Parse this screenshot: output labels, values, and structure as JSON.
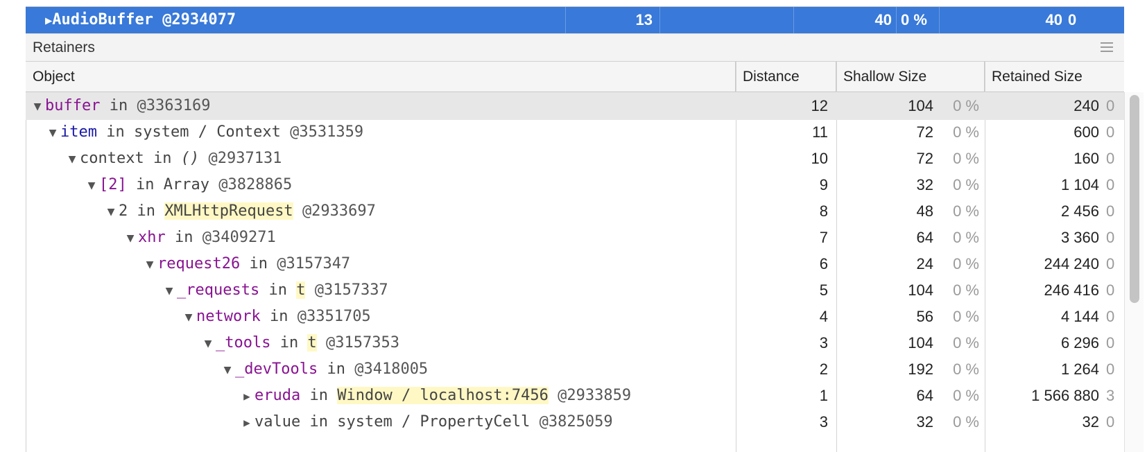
{
  "selected_object": {
    "name": "AudioBuffer @2934077",
    "distance": "13",
    "shallow_size": "40",
    "shallow_percent": "0 %",
    "retained_size": "40",
    "retained_percent": "0"
  },
  "retainers_panel": {
    "title": "Retainers"
  },
  "columns": {
    "object": "Object",
    "distance": "Distance",
    "shallow_size": "Shallow Size",
    "retained_size": "Retained Size"
  },
  "rows": [
    {
      "prop": "buffer",
      "kw": "in",
      "ctx": "",
      "ctx_hl": false,
      "id": "@3363169",
      "distance": "12",
      "shallow": "104",
      "shallow_pct": "0 %",
      "retained": "240",
      "retained_pct": "0"
    },
    {
      "prop": "item",
      "kw": "in",
      "ctx": "system / Context",
      "ctx_hl": false,
      "id": "@3531359",
      "distance": "11",
      "shallow": "72",
      "shallow_pct": "0 %",
      "retained": "600",
      "retained_pct": "0"
    },
    {
      "prop": "context",
      "kw": "in",
      "ctx": "()",
      "ctx_hl": false,
      "id": "@2937131",
      "distance": "10",
      "shallow": "72",
      "shallow_pct": "0 %",
      "retained": "160",
      "retained_pct": "0"
    },
    {
      "prop": "[2]",
      "kw": "in",
      "ctx": "Array",
      "ctx_hl": false,
      "id": "@3828865",
      "distance": "9",
      "shallow": "32",
      "shallow_pct": "0 %",
      "retained": "1 104",
      "retained_pct": "0"
    },
    {
      "prop": "2",
      "kw": "in",
      "ctx": "XMLHttpRequest",
      "ctx_hl": true,
      "id": "@2933697",
      "distance": "8",
      "shallow": "48",
      "shallow_pct": "0 %",
      "retained": "2 456",
      "retained_pct": "0"
    },
    {
      "prop": "xhr",
      "kw": "in",
      "ctx": "",
      "ctx_hl": false,
      "id": "@3409271",
      "distance": "7",
      "shallow": "64",
      "shallow_pct": "0 %",
      "retained": "3 360",
      "retained_pct": "0"
    },
    {
      "prop": "request26",
      "kw": "in",
      "ctx": "",
      "ctx_hl": false,
      "id": "@3157347",
      "distance": "6",
      "shallow": "24",
      "shallow_pct": "0 %",
      "retained": "244 240",
      "retained_pct": "0"
    },
    {
      "prop": "_requests",
      "kw": "in",
      "ctx": "t",
      "ctx_hl": true,
      "id": "@3157337",
      "distance": "5",
      "shallow": "104",
      "shallow_pct": "0 %",
      "retained": "246 416",
      "retained_pct": "0"
    },
    {
      "prop": "network",
      "kw": "in",
      "ctx": "",
      "ctx_hl": false,
      "id": "@3351705",
      "distance": "4",
      "shallow": "56",
      "shallow_pct": "0 %",
      "retained": "4 144",
      "retained_pct": "0"
    },
    {
      "prop": "_tools",
      "kw": "in",
      "ctx": "t",
      "ctx_hl": true,
      "id": "@3157353",
      "distance": "3",
      "shallow": "104",
      "shallow_pct": "0 %",
      "retained": "6 296",
      "retained_pct": "0"
    },
    {
      "prop": "_devTools",
      "kw": "in",
      "ctx": "",
      "ctx_hl": false,
      "id": "@3418005",
      "distance": "2",
      "shallow": "192",
      "shallow_pct": "0 %",
      "retained": "1 264",
      "retained_pct": "0"
    },
    {
      "prop": "eruda",
      "kw": "in",
      "ctx": "Window / localhost:7456",
      "ctx_hl": true,
      "id": "@2933859",
      "distance": "1",
      "shallow": "64",
      "shallow_pct": "0 %",
      "retained": "1 566 880",
      "retained_pct": "3"
    },
    {
      "prop": "value",
      "kw": "in",
      "ctx": "system / PropertyCell",
      "ctx_hl": false,
      "id": "@3825059",
      "distance": "3",
      "shallow": "32",
      "shallow_pct": "0 %",
      "retained": "32",
      "retained_pct": "0"
    }
  ]
}
